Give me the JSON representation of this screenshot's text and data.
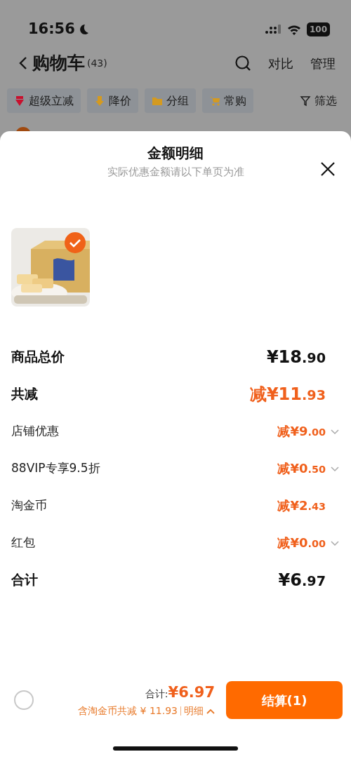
{
  "status_bar": {
    "time": "16:56",
    "battery": "100"
  },
  "nav": {
    "title": "购物车",
    "count": "(43)",
    "actions": [
      "对比",
      "管理"
    ]
  },
  "filters": [
    {
      "label": "超级立减",
      "kind": "drop"
    },
    {
      "label": "降价",
      "kind": "down"
    },
    {
      "label": "分组",
      "kind": "folder"
    },
    {
      "label": "常购",
      "kind": "cart"
    },
    {
      "label": "筛选",
      "kind": "filter"
    }
  ],
  "sheet": {
    "title": "金额明细",
    "subtitle": "实际优惠金额请以下单页为准",
    "products": [
      {
        "kind": "picture",
        "selected": true
      }
    ],
    "rows": [
      {
        "label": "商品总价",
        "amount": "¥18.90",
        "kind": "major",
        "highlighted": false,
        "expandable": false
      },
      {
        "label": "共减",
        "amount": "减¥11.93",
        "kind": "major",
        "highlighted": true,
        "expandable": false
      },
      {
        "label": "店铺优惠",
        "amount": "减¥9.00",
        "kind": "minor",
        "highlighted": true,
        "expandable": true
      },
      {
        "label": "88VIP专享9.5折",
        "amount": "减¥0.50",
        "kind": "minor",
        "highlighted": true,
        "expandable": true
      },
      {
        "label": "淘金币",
        "amount": "减¥2.43",
        "kind": "minor",
        "highlighted": true,
        "expandable": false
      },
      {
        "label": "红包",
        "amount": "减¥0.00",
        "kind": "minor",
        "highlighted": true,
        "expandable": true
      },
      {
        "label": "合计",
        "amount": "¥6.97",
        "kind": "major",
        "highlighted": false,
        "expandable": false
      }
    ]
  },
  "footer": {
    "select_all_checked": false,
    "total_label": "合计:",
    "total": "¥6.97",
    "savings": "含淘金币共减 ¥ 11.93",
    "detail": "明细",
    "detail_expanded": true,
    "checkout": "结算(1)"
  }
}
